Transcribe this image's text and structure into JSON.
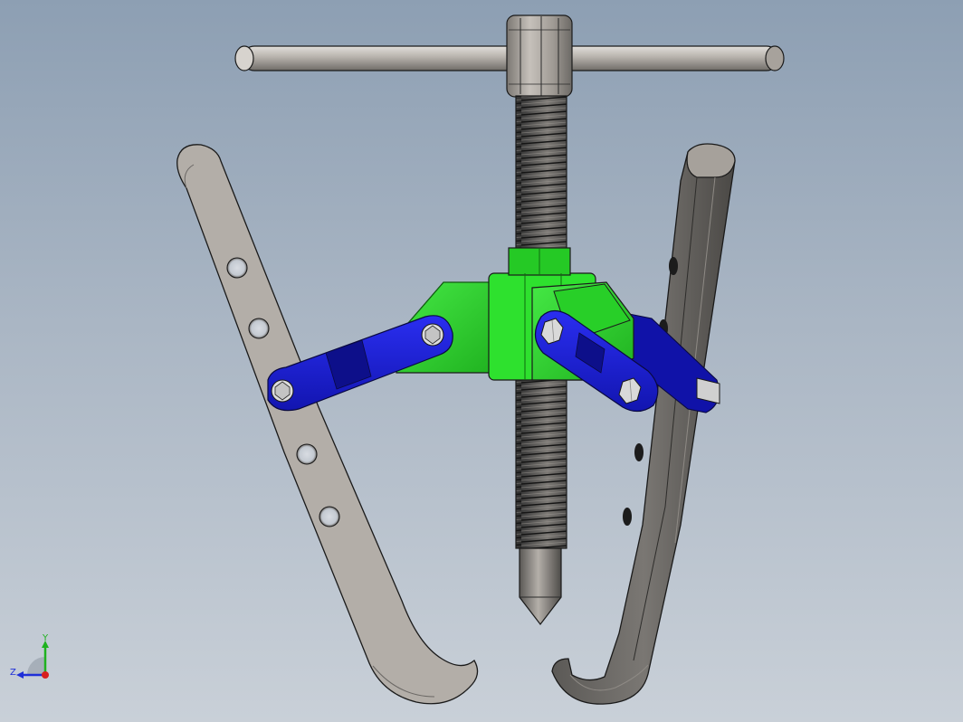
{
  "colors": {
    "steel": "#b3aea8",
    "steel_dark": "#6c6a67",
    "green": "#2cd12c",
    "green_dark": "#179a17",
    "blue": "#1c1fd6",
    "blue_dark": "#0b0c86",
    "outline": "#1a1a1a"
  },
  "triad": {
    "y_label": "Y",
    "z_label": "Z",
    "x_color": "#d81f1f",
    "y_color": "#1fb21f",
    "z_color": "#1f2fd8"
  }
}
